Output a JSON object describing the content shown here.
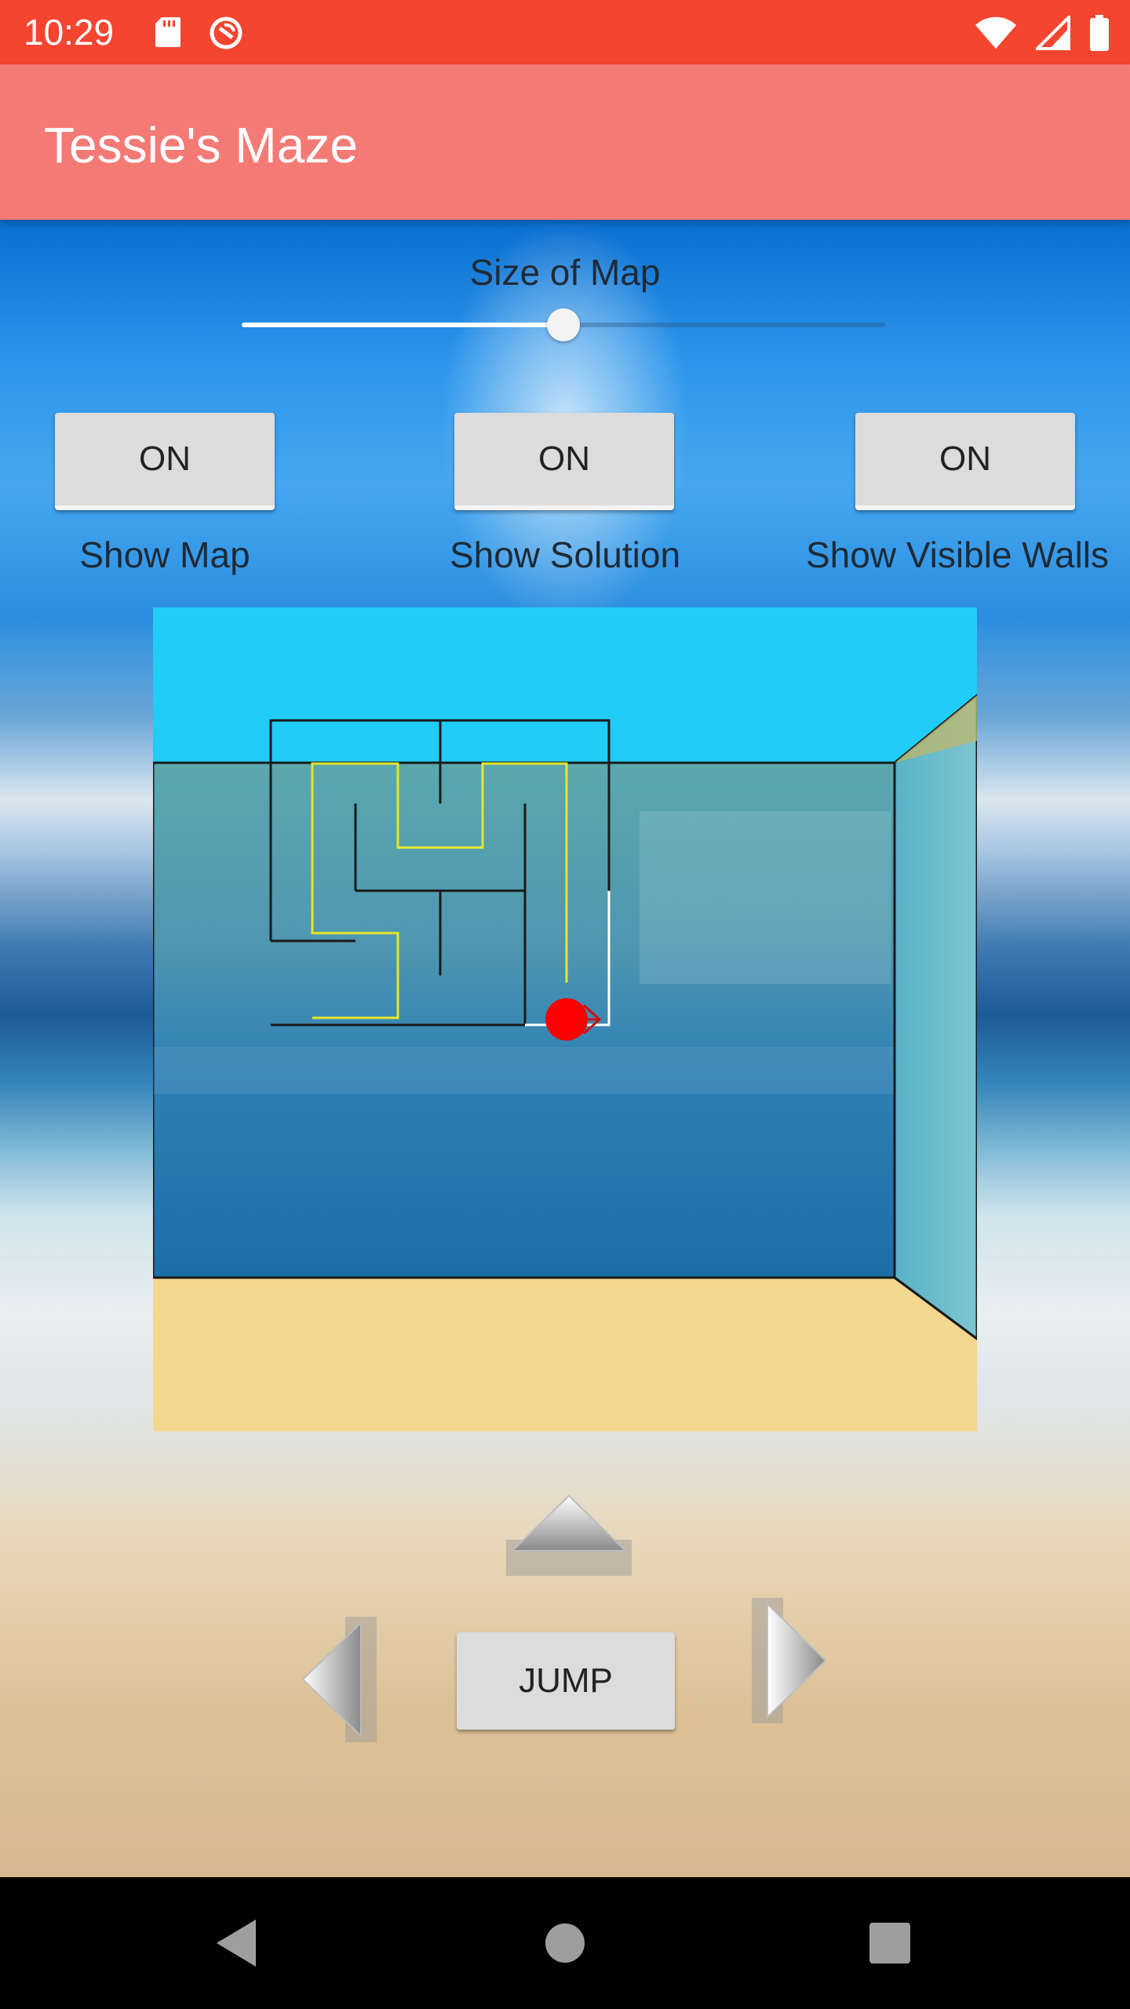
{
  "status_bar": {
    "time": "10:29",
    "icons": [
      "sd-card-icon",
      "sync-icon",
      "wifi-icon",
      "signal-icon",
      "battery-icon"
    ]
  },
  "app_bar": {
    "title": "Tessie's Maze",
    "color": "#f47a76"
  },
  "size_slider": {
    "label": "Size of Map",
    "value_fraction": 0.5
  },
  "toggles": {
    "show_map": {
      "state": "ON",
      "label": "Show Map"
    },
    "show_solution": {
      "state": "ON",
      "label": "Show Solution"
    },
    "show_visible_walls": {
      "state": "ON",
      "label": "Show Visible Walls"
    }
  },
  "controls": {
    "up_icon": "up-arrow-icon",
    "left_icon": "left-arrow-icon",
    "right_icon": "right-arrow-icon",
    "jump_label": "JUMP"
  },
  "nav_bar": {
    "icons": [
      "back-icon",
      "home-icon",
      "recents-icon"
    ]
  },
  "colors": {
    "status_bar": "#f44530",
    "sky": "#21ccf6",
    "floor": "#f4d78e",
    "solution_path": "#e6e62a",
    "player": "#ff0000"
  }
}
